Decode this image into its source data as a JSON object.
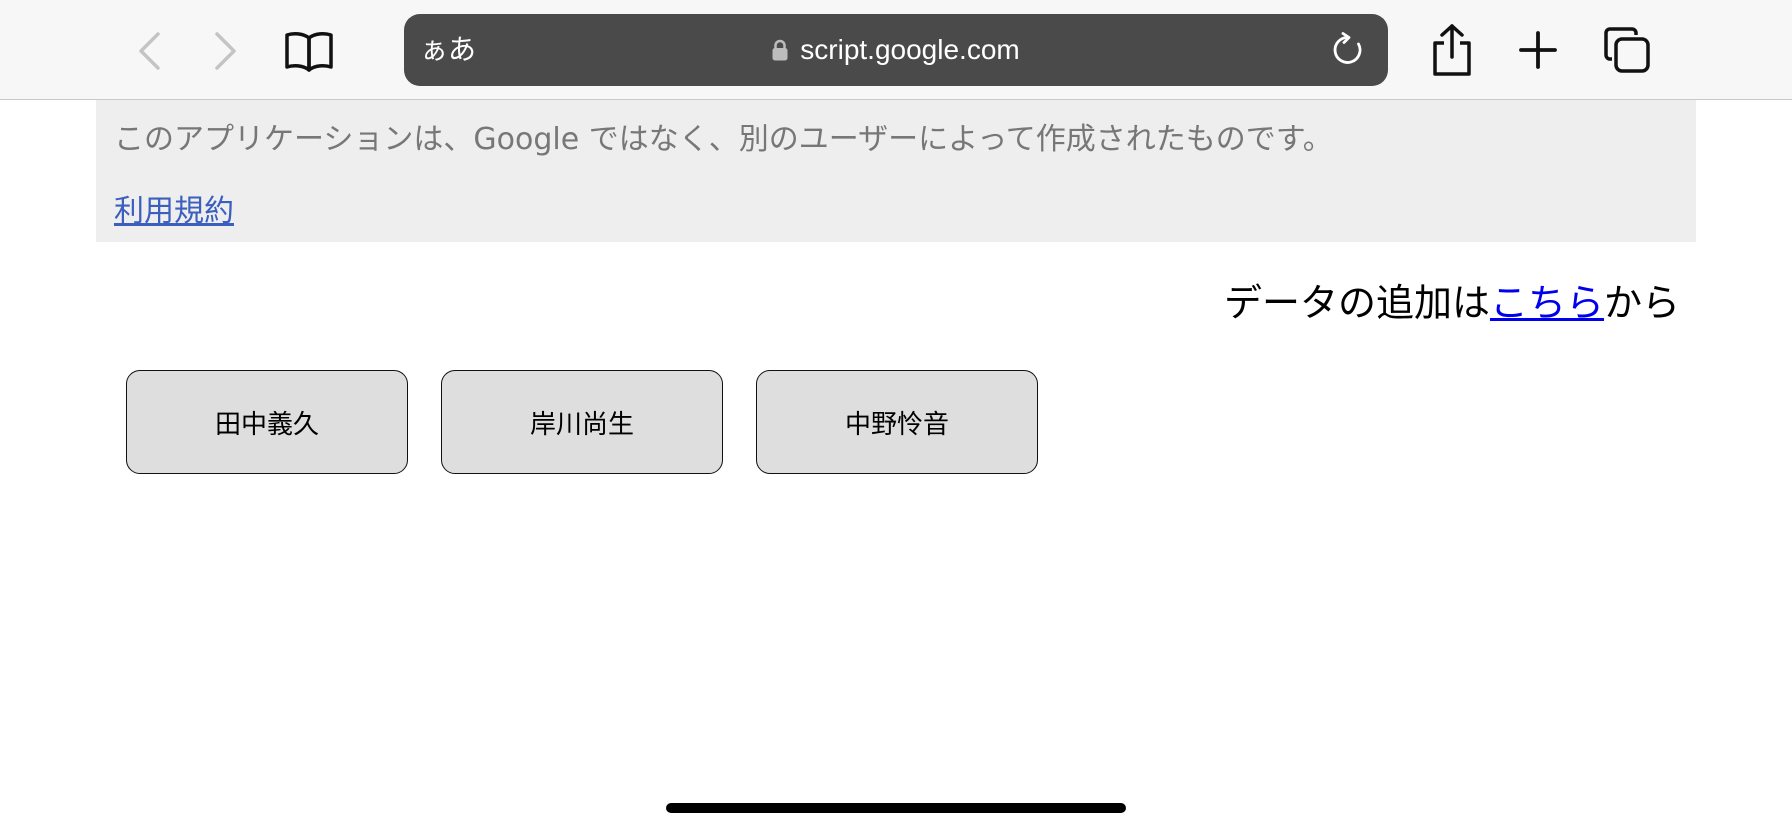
{
  "browser": {
    "reader_label": "ぁあ",
    "url": "script.google.com",
    "icons": {
      "back": "chevron-left-icon",
      "forward": "chevron-right-icon",
      "bookmarks": "book-icon",
      "lock": "lock-icon",
      "reload": "reload-icon",
      "share": "share-icon",
      "new_tab": "plus-icon",
      "tabs": "tabs-icon"
    }
  },
  "notice": {
    "text": "このアプリケーションは、Google ではなく、別のユーザーによって作成されたものです。",
    "terms_link": "利用規約"
  },
  "add_data": {
    "prefix": "データの追加は",
    "link": "こちら",
    "suffix": "から"
  },
  "people": [
    "田中義久",
    "岸川尚生",
    "中野怜音"
  ],
  "colors": {
    "toolbar_bg": "#f7f7f7",
    "address_bar_bg": "#4a4a4a",
    "notice_bg": "#eeeeee",
    "notice_text": "#777777",
    "terms_link": "#3c5fbf",
    "add_link": "#0000ee",
    "button_bg": "#dedede"
  }
}
